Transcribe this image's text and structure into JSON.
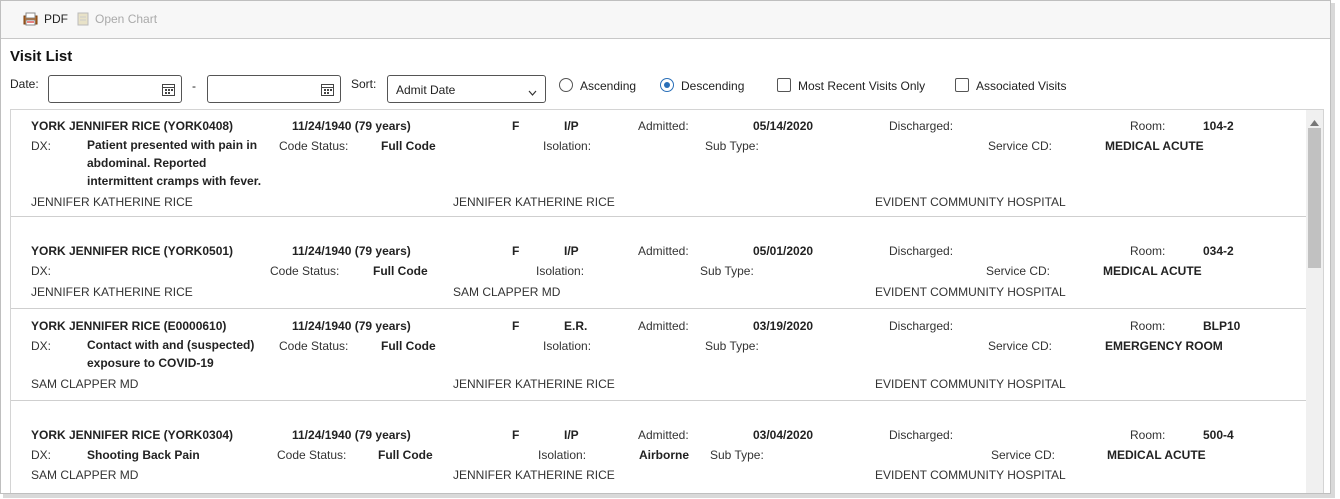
{
  "toolbar": {
    "pdf_label": "PDF",
    "open_chart_label": "Open Chart"
  },
  "page_title": "Visit List",
  "filters": {
    "date_label": "Date:",
    "date_sep": "-",
    "date_from": "",
    "date_to": "",
    "sort_label": "Sort:",
    "sort_value": "Admit Date",
    "ascending_label": "Ascending",
    "descending_label": "Descending",
    "sort_direction": "Descending",
    "most_recent_label": "Most Recent Visits Only",
    "associated_label": "Associated Visits"
  },
  "labels": {
    "dx": "DX:",
    "code_status": "Code Status:",
    "isolation": "Isolation:",
    "sub_type": "Sub Type:",
    "admitted": "Admitted:",
    "discharged": "Discharged:",
    "room": "Room:",
    "service_cd": "Service CD:"
  },
  "visits": [
    {
      "name": "YORK JENNIFER RICE (YORK0408)",
      "dob": "11/24/1940 (79 years)",
      "sex": "F",
      "type": "I/P",
      "admitted": "05/14/2020",
      "discharged": "",
      "room": "104-2",
      "dx": "Patient presented with pain in abdominal. Reported intermittent cramps with fever.",
      "code_status": "Full Code",
      "isolation": "",
      "sub_type": "",
      "service_cd": "MEDICAL ACUTE",
      "provider1": "JENNIFER KATHERINE RICE",
      "provider2": "JENNIFER KATHERINE RICE",
      "facility": "EVIDENT COMMUNITY HOSPITAL"
    },
    {
      "name": "YORK JENNIFER RICE (YORK0501)",
      "dob": "11/24/1940 (79 years)",
      "sex": "F",
      "type": "I/P",
      "admitted": "05/01/2020",
      "discharged": "",
      "room": "034-2",
      "dx": "",
      "code_status": "Full Code",
      "isolation": "",
      "sub_type": "",
      "service_cd": "MEDICAL ACUTE",
      "provider1": "JENNIFER KATHERINE RICE",
      "provider2": "SAM CLAPPER MD",
      "facility": "EVIDENT COMMUNITY HOSPITAL"
    },
    {
      "name": "YORK JENNIFER RICE (E0000610)",
      "dob": "11/24/1940 (79 years)",
      "sex": "F",
      "type": "E.R.",
      "admitted": "03/19/2020",
      "discharged": "",
      "room": "BLP10",
      "dx": "Contact with and (suspected) exposure to COVID-19",
      "code_status": "Full Code",
      "isolation": "",
      "sub_type": "",
      "service_cd": "EMERGENCY ROOM",
      "provider1": "SAM CLAPPER MD",
      "provider2": "JENNIFER KATHERINE RICE",
      "facility": "EVIDENT COMMUNITY HOSPITAL"
    },
    {
      "name": "YORK JENNIFER RICE (YORK0304)",
      "dob": "11/24/1940 (79 years)",
      "sex": "F",
      "type": "I/P",
      "admitted": "03/04/2020",
      "discharged": "",
      "room": "500-4",
      "dx": "Shooting Back Pain",
      "code_status": "Full Code",
      "isolation": "Airborne",
      "sub_type": "",
      "service_cd": "MEDICAL ACUTE",
      "provider1": "SAM CLAPPER MD",
      "provider2": "JENNIFER KATHERINE RICE",
      "facility": "EVIDENT COMMUNITY HOSPITAL"
    }
  ]
}
